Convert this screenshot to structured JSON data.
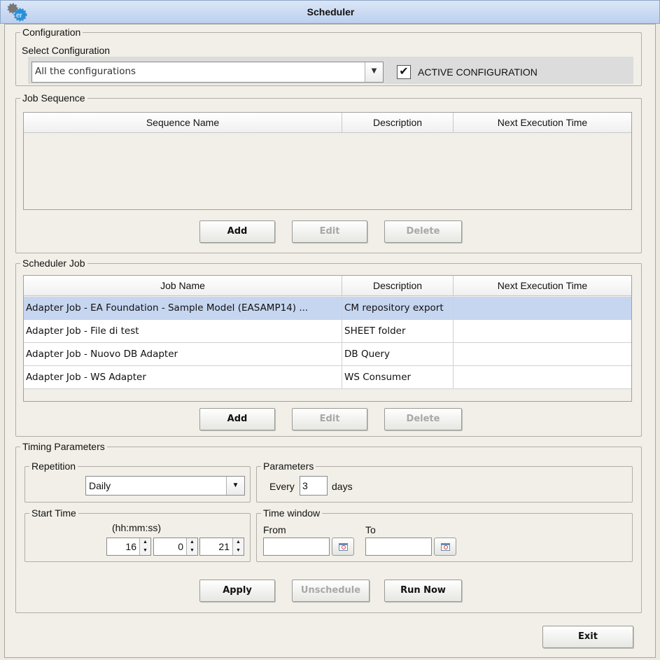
{
  "window": {
    "title": "Scheduler"
  },
  "configuration": {
    "legend": "Configuration",
    "select_label": "Select Configuration",
    "selected": "All the configurations",
    "active_label": "ACTIVE CONFIGURATION",
    "active_checked": true
  },
  "job_sequence": {
    "legend": "Job Sequence",
    "columns": [
      "Sequence Name",
      "Description",
      "Next Execution Time"
    ],
    "rows": [],
    "buttons": {
      "add": "Add",
      "edit": "Edit",
      "delete": "Delete"
    }
  },
  "scheduler_job": {
    "legend": "Scheduler Job",
    "columns": [
      "Job Name",
      "Description",
      "Next Execution Time"
    ],
    "rows": [
      {
        "name": "Adapter Job - EA Foundation - Sample Model (EASAMP14) ...",
        "description": "CM repository export",
        "next": ""
      },
      {
        "name": "Adapter Job - File di test",
        "description": "SHEET folder",
        "next": ""
      },
      {
        "name": "Adapter Job - Nuovo DB Adapter",
        "description": "DB Query",
        "next": ""
      },
      {
        "name": "Adapter Job - WS Adapter",
        "description": "WS Consumer",
        "next": ""
      }
    ],
    "selected_row": 0,
    "buttons": {
      "add": "Add",
      "edit": "Edit",
      "delete": "Delete"
    }
  },
  "timing": {
    "legend": "Timing Parameters",
    "repetition": {
      "legend": "Repetition",
      "value": "Daily"
    },
    "parameters": {
      "legend": "Parameters",
      "every": "Every",
      "value": "3",
      "unit": "days"
    },
    "start_time": {
      "legend": "Start Time",
      "format": "(hh:mm:ss)",
      "hh": "16",
      "mm": "0",
      "ss": "21"
    },
    "time_window": {
      "legend": "Time window",
      "from_label": "From",
      "to_label": "To",
      "from": "",
      "to": ""
    },
    "buttons": {
      "apply": "Apply",
      "unschedule": "Unschedule",
      "run_now": "Run Now"
    }
  },
  "exit": "Exit"
}
